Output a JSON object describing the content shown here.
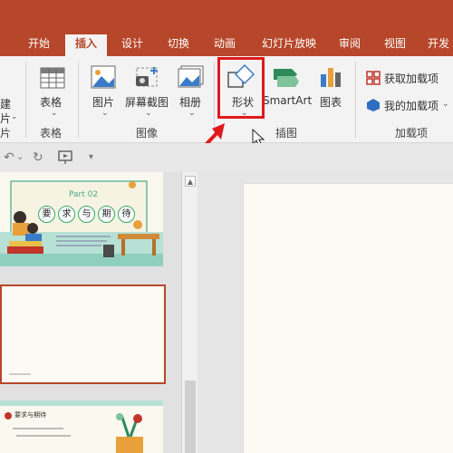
{
  "tabs": [
    "开始",
    "插入",
    "设计",
    "切换",
    "动画",
    "幻灯片放映",
    "审阅",
    "视图",
    "开发"
  ],
  "ribbon": {
    "partial_left_top": "建",
    "partial_left_bottom": "片",
    "partial_left_group": "片",
    "table_label": "表格",
    "table_group": "表格",
    "picture_label": "图片",
    "screenshot_label": "屏幕截图",
    "album_label": "相册",
    "image_group": "图像",
    "shapes_label": "形状",
    "smartart_label": "SmartArt",
    "chart_label": "图表",
    "illustration_group": "插图",
    "get_addins_label": "获取加载项",
    "my_addins_label": "我的加载项",
    "addins_group": "加载项"
  },
  "thumbnails": {
    "slide1_part": "Part 02",
    "slide1_title": [
      "要",
      "求",
      "与",
      "期",
      "待"
    ],
    "slide3_title": "要求与期待"
  },
  "colors": {
    "accent": "#b7472a",
    "highlight": "#e0191d"
  }
}
